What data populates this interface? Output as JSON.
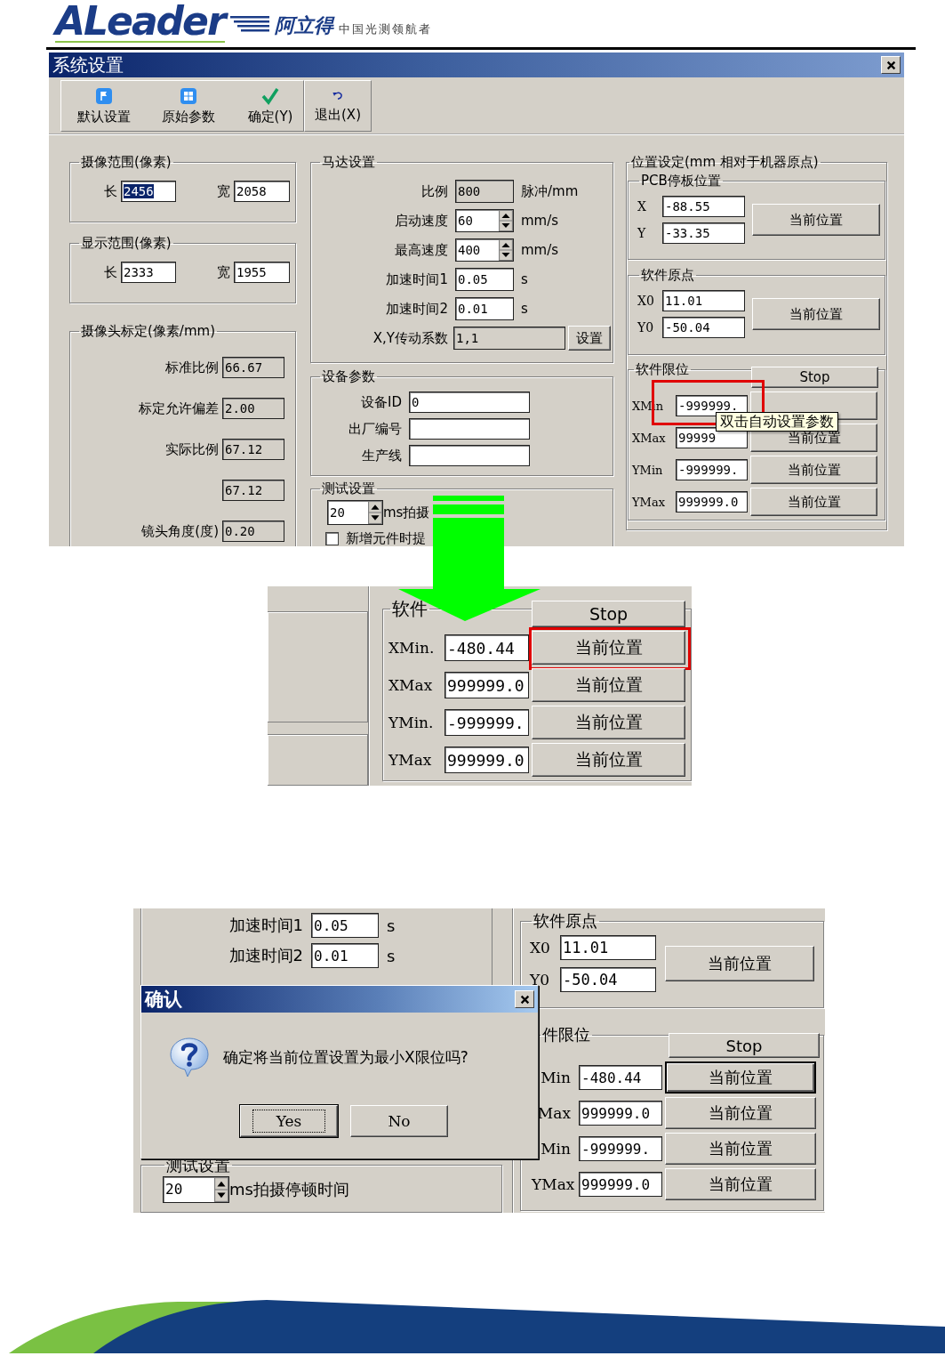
{
  "header": {
    "logo": "ALeader",
    "brand": "阿立得",
    "slogan": "中国光测领航者"
  },
  "settings_window": {
    "title": "系统设置",
    "toolbar": [
      {
        "label": "默认设置",
        "kind": "flag"
      },
      {
        "label": "原始参数",
        "kind": "tiles"
      },
      {
        "label": "确定(Y)",
        "kind": "check"
      },
      {
        "label": "退出(X)",
        "kind": "undo"
      }
    ],
    "camera_range": {
      "title": "摄像范围(像素)",
      "fields": [
        {
          "label": "长",
          "value": "2456",
          "selected": true
        },
        {
          "label": "宽",
          "value": "2058",
          "selected": false
        }
      ]
    },
    "display_range": {
      "title": "显示范围(像素)",
      "fields": [
        {
          "label": "长",
          "value": "2333",
          "selected": false
        },
        {
          "label": "宽",
          "value": "1955",
          "selected": false
        }
      ]
    },
    "calibration": {
      "title": "摄像头标定(像素/mm)",
      "rows": [
        {
          "label": "标准比例",
          "value": "66.67"
        },
        {
          "label": "标定允许偏差",
          "value": "2.00"
        },
        {
          "label": "实际比例",
          "value": "67.12"
        },
        {
          "value": "67.12"
        },
        {
          "label": "镜头角度(度)",
          "value": "0.20"
        }
      ]
    },
    "motor": {
      "title": "马达设置",
      "rows": [
        {
          "kind": "readonly",
          "label": "比例",
          "value": "800",
          "unit": "脉冲/mm"
        },
        {
          "kind": "spin",
          "label": "启动速度",
          "value": "60",
          "unit": "mm/s"
        },
        {
          "kind": "spin",
          "label": "最高速度",
          "value": "400",
          "unit": "mm/s"
        },
        {
          "kind": "text",
          "label": "加速时间1",
          "value": "0.05",
          "unit": "s"
        },
        {
          "kind": "text",
          "label": "加速时间2",
          "value": "0.01",
          "unit": "s"
        },
        {
          "kind": "action",
          "label": "X,Y传动系数",
          "value": "1,1",
          "button": "设置"
        }
      ]
    },
    "device": {
      "title": "设备参数",
      "rows": [
        {
          "label": "设备ID",
          "value": "0"
        },
        {
          "label": "出厂编号"
        },
        {
          "label": "生产线"
        }
      ]
    },
    "test": {
      "title": "测试设置",
      "delay": "20",
      "delay_label": "ms拍摄",
      "checkbox": {
        "label": "新增元件时提",
        "checked": false
      }
    },
    "position": {
      "title": "位置设定(mm 相对于机器原点)",
      "groups": [
        {
          "title": "PCB停板位置",
          "fields": [
            {
              "label": "X",
              "value": "-88.55"
            },
            {
              "label": "Y",
              "value": "-33.35"
            }
          ],
          "button": "当前位置"
        },
        {
          "title": "软件原点",
          "fields": [
            {
              "label": "X0",
              "value": "11.01"
            },
            {
              "label": "Y0",
              "value": "-50.04"
            }
          ],
          "button": "当前位置"
        }
      ]
    },
    "limits": {
      "title": "软件限位",
      "stop": "Stop",
      "rows": [
        {
          "label": "XMin",
          "value": "-999999.",
          "highlighted": true
        },
        {
          "label": "XMax",
          "value": "99999",
          "button": "当前位置",
          "highlighted": false
        },
        {
          "label": "YMin",
          "value": "-999999.",
          "button": "当前位置",
          "highlighted": false
        },
        {
          "label": "YMax",
          "value": "999999.0",
          "button": "当前位置",
          "highlighted": false
        }
      ]
    },
    "tooltip": "双击自动设置参数"
  },
  "zoom_view": {
    "limits": {
      "title": "软件",
      "stop": "Stop",
      "rows": [
        {
          "label": "XMin.",
          "value": "-480.44",
          "button": "当前位置",
          "highlighted": true
        },
        {
          "label": "XMax",
          "value": "999999.0",
          "button": "当前位置",
          "highlighted": false
        },
        {
          "label": "YMin.",
          "value": "-999999.",
          "button": "当前位置",
          "highlighted": false
        },
        {
          "label": "YMax",
          "value": "999999.0",
          "button": "当前位置",
          "highlighted": false
        }
      ]
    }
  },
  "confirm_view": {
    "motor_rows": [
      {
        "label": "加速时间1",
        "value": "0.05",
        "unit": "s"
      },
      {
        "label": "加速时间2",
        "value": "0.01",
        "unit": "s"
      }
    ],
    "test": {
      "title": "测试设置",
      "delay": "20",
      "delay_label": "ms拍摄停顿时间"
    },
    "origin": {
      "title": "软件原点",
      "fields": [
        {
          "label": "X0",
          "value": "11.01"
        },
        {
          "label": "Y0",
          "value": "-50.04"
        }
      ],
      "button": "当前位置"
    },
    "limits": {
      "title": "件限位",
      "stop": "Stop",
      "rows": [
        {
          "label": "Min",
          "value": "-480.44",
          "button": "当前位置",
          "focused": true
        },
        {
          "label": "Max",
          "value": "999999.0",
          "button": "当前位置",
          "focused": false
        },
        {
          "label": "Min",
          "value": "-999999.",
          "button": "当前位置",
          "focused": false
        },
        {
          "label": "YMax",
          "value": "999999.0",
          "button": "当前位置",
          "focused": false
        }
      ]
    },
    "dialog": {
      "title": "确认",
      "message": "确定将当前位置设置为最小X限位吗?",
      "buttons": [
        {
          "label": "Yes",
          "selected": true
        },
        {
          "label": "No",
          "selected": false
        }
      ]
    }
  }
}
